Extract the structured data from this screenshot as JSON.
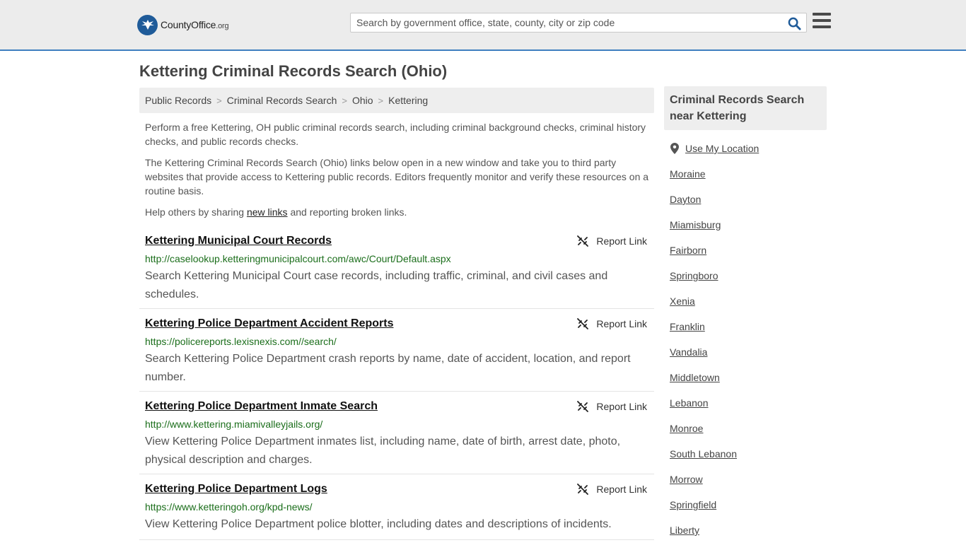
{
  "header": {
    "logo_brand": "CountyOffice",
    "logo_suffix": ".org",
    "search_placeholder": "Search by government office, state, county, city or zip code",
    "search_icon": "search-icon",
    "menu_icon": "hamburger-menu-icon",
    "accent_color": "#3f7fbf"
  },
  "page": {
    "title": "Kettering Criminal Records Search (Ohio)"
  },
  "breadcrumb": [
    "Public Records",
    "Criminal Records Search",
    "Ohio",
    "Kettering"
  ],
  "intro": {
    "p1": "Perform a free Kettering, OH public criminal records search, including criminal background checks, criminal history checks, and public records checks.",
    "p2": "The Kettering Criminal Records Search (Ohio) links below open in a new window and take you to third party websites that provide access to Kettering public records. Editors frequently monitor and verify these resources on a routine basis.",
    "p3_before": "Help others by sharing ",
    "p3_link": "new links",
    "p3_after": " and reporting broken links."
  },
  "report_label": "Report Link",
  "records": [
    {
      "title": "Kettering Municipal Court Records",
      "url": "http://caselookup.ketteringmunicipalcourt.com/awc/Court/Default.aspx",
      "desc": "Search Kettering Municipal Court case records, including traffic, criminal, and civil cases and schedules."
    },
    {
      "title": "Kettering Police Department Accident Reports",
      "url": "https://policereports.lexisnexis.com//search/",
      "desc": "Search Kettering Police Department crash reports by name, date of accident, location, and report number."
    },
    {
      "title": "Kettering Police Department Inmate Search",
      "url": "http://www.kettering.miamivalleyjails.org/",
      "desc": "View Kettering Police Department inmates list, including name, date of birth, arrest date, photo, physical description and charges."
    },
    {
      "title": "Kettering Police Department Logs",
      "url": "https://www.ketteringoh.org/kpd-news/",
      "desc": "View Kettering Police Department police blotter, including dates and descriptions of incidents."
    }
  ],
  "sidebar": {
    "heading": "Criminal Records Search near Kettering",
    "use_location": "Use My Location",
    "location_icon": "map-pin-icon",
    "cities": [
      "Moraine",
      "Dayton",
      "Miamisburg",
      "Fairborn",
      "Springboro",
      "Xenia",
      "Franklin",
      "Vandalia",
      "Middletown",
      "Lebanon",
      "Monroe",
      "South Lebanon",
      "Morrow",
      "Springfield",
      "Liberty"
    ]
  }
}
